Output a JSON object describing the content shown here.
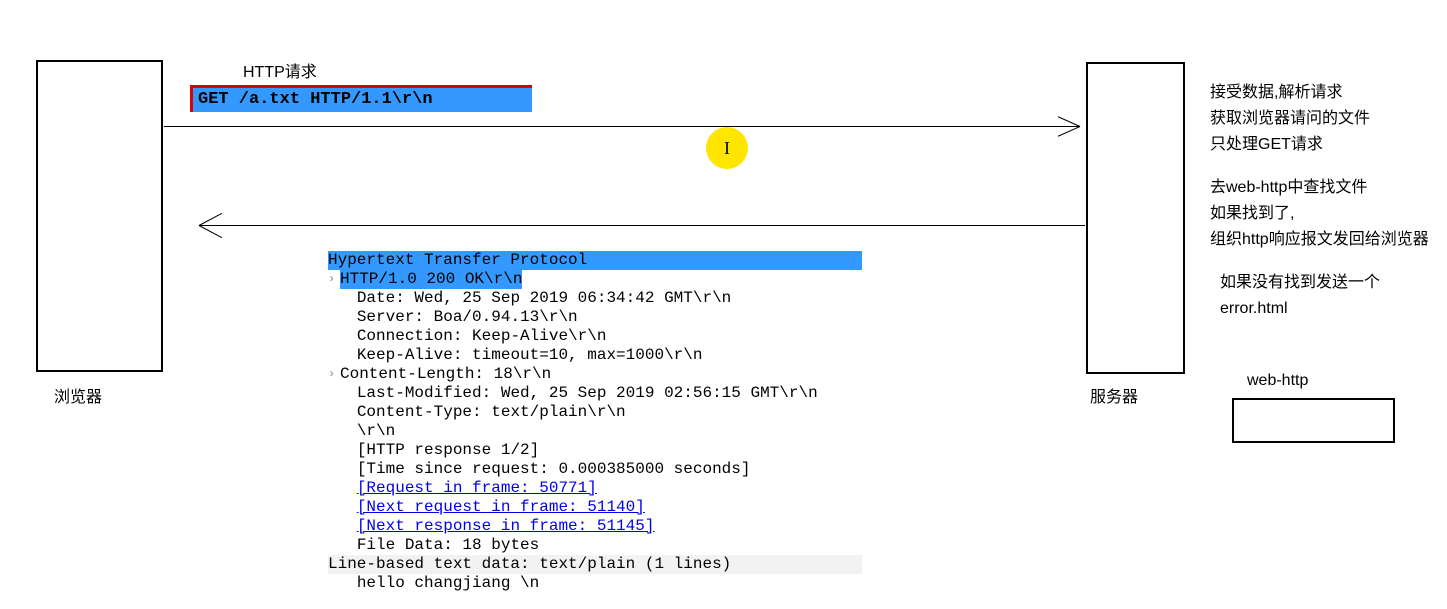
{
  "labels": {
    "http_request_title": "HTTP请求",
    "browser": "浏览器",
    "server": "服务器",
    "web_http": "web-http"
  },
  "request_line": "GET /a.txt HTTP/1.1\\r\\n",
  "cursor_glyph": "I",
  "response": {
    "title": "Hypertext Transfer Protocol",
    "status": "HTTP/1.0 200 OK\\r\\n",
    "lines": [
      "Date: Wed, 25 Sep 2019 06:34:42 GMT\\r\\n",
      "Server: Boa/0.94.13\\r\\n",
      "Connection: Keep-Alive\\r\\n",
      "Keep-Alive: timeout=10, max=1000\\r\\n"
    ],
    "content_length": "Content-Length: 18\\r\\n",
    "lines2": [
      "Last-Modified: Wed, 25 Sep 2019 02:56:15 GMT\\r\\n",
      "Content-Type: text/plain\\r\\n",
      "\\r\\n",
      "[HTTP response 1/2]",
      "[Time since request: 0.000385000 seconds]"
    ],
    "links": [
      "[Request in frame: 50771]",
      "[Next request in frame: 51140]",
      "[Next response in frame: 51145]"
    ],
    "file_data": "File Data: 18 bytes",
    "line_based": "Line-based text data: text/plain (1 lines)",
    "body": "hello changjiang \\n"
  },
  "notes": {
    "group1": [
      "接受数据,解析请求",
      "获取浏览器请问的文件",
      "只处理GET请求"
    ],
    "group2": [
      "去web-http中查找文件",
      "如果找到了,",
      "组织http响应报文发回给浏览器"
    ],
    "group3": [
      "如果没有找到发送一个",
      "error.html"
    ]
  }
}
